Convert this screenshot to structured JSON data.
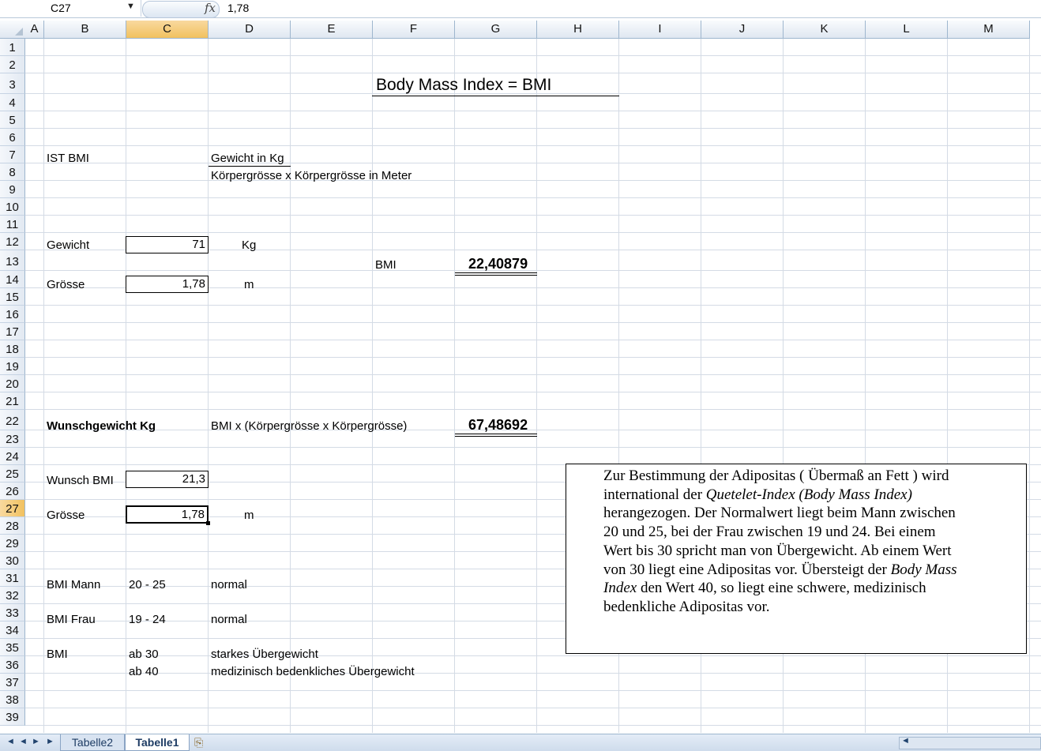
{
  "formula_bar": {
    "name_box": "C27",
    "fx_symbol": "fx",
    "value": "1,78"
  },
  "columns": [
    "A",
    "B",
    "C",
    "D",
    "E",
    "F",
    "G",
    "H",
    "I",
    "J",
    "K",
    "L",
    "M"
  ],
  "active_column": "C",
  "rows": [
    "1",
    "2",
    "3",
    "4",
    "5",
    "6",
    "7",
    "8",
    "9",
    "10",
    "11",
    "12",
    "13",
    "14",
    "15",
    "16",
    "17",
    "18",
    "19",
    "20",
    "21",
    "22",
    "23",
    "24",
    "25",
    "26",
    "27",
    "28",
    "29",
    "30",
    "31",
    "32",
    "33",
    "34",
    "35",
    "36",
    "37",
    "38",
    "39"
  ],
  "active_row": "27",
  "sheet": {
    "title": "Body Mass Index = BMI",
    "ist_bmi_label": "IST  BMI",
    "formula_numerator": "Gewicht in Kg",
    "formula_denominator": "Körpergrösse x Körpergrösse in Meter",
    "gewicht_label": "Gewicht",
    "gewicht_value": "71",
    "gewicht_unit": "Kg",
    "bmi_label": "BMI",
    "bmi_result": "22,40879",
    "groesse_label": "Grösse",
    "groesse_value": "1,78",
    "groesse_unit": "m",
    "wunschgewicht_label": "Wunschgewicht   Kg",
    "wunschgewicht_formula": "BMI  x (Körpergrösse x Körpergrösse)",
    "wunschgewicht_result": "67,48692",
    "wunsch_bmi_label": "Wunsch BMI",
    "wunsch_bmi_value": "21,3",
    "groesse2_label": "Grösse",
    "groesse2_value": "1,78",
    "groesse2_unit": "m",
    "bmi_mann_label": "BMI Mann",
    "bmi_mann_range": "20 - 25",
    "bmi_mann_status": "normal",
    "bmi_frau_label": "BMI Frau",
    "bmi_frau_range": "19 - 24",
    "bmi_frau_status": "normal",
    "bmi_label2": "BMI",
    "ab30": "ab 30",
    "ab30_status": "starkes Übergewicht",
    "ab40": "ab 40",
    "ab40_status": "medizinisch bedenkliches Übergewicht"
  },
  "textbox": {
    "p1": "Zur Bestimmung der Adipositas ( Übermaß an Fett ) wird international der ",
    "p1_italic": "Quetelet-Index (Body Mass Index)",
    "p2": " herangezogen. Der Normalwert liegt beim Mann zwischen 20 und 25, bei der Frau zwischen 19 und 24. Bei einem Wert bis 30 spricht man von Übergewicht. Ab einem Wert von 30 liegt eine Adipositas vor. Übersteigt der ",
    "p2_italic": "Body Mass Index",
    "p3": " den Wert 40, so liegt eine schwere, medizinisch bedenkliche Adipositas vor."
  },
  "tabs": {
    "nav_first": "◄",
    "nav_prev": "◄",
    "nav_next": "►",
    "nav_last": "►",
    "tab1": "Tabelle2",
    "tab2": "Tabelle1",
    "active": "Tabelle1"
  },
  "colors": {
    "grid": "#d4dbe5",
    "header": "#dfe7f1",
    "active_header": "#f1c15f"
  }
}
